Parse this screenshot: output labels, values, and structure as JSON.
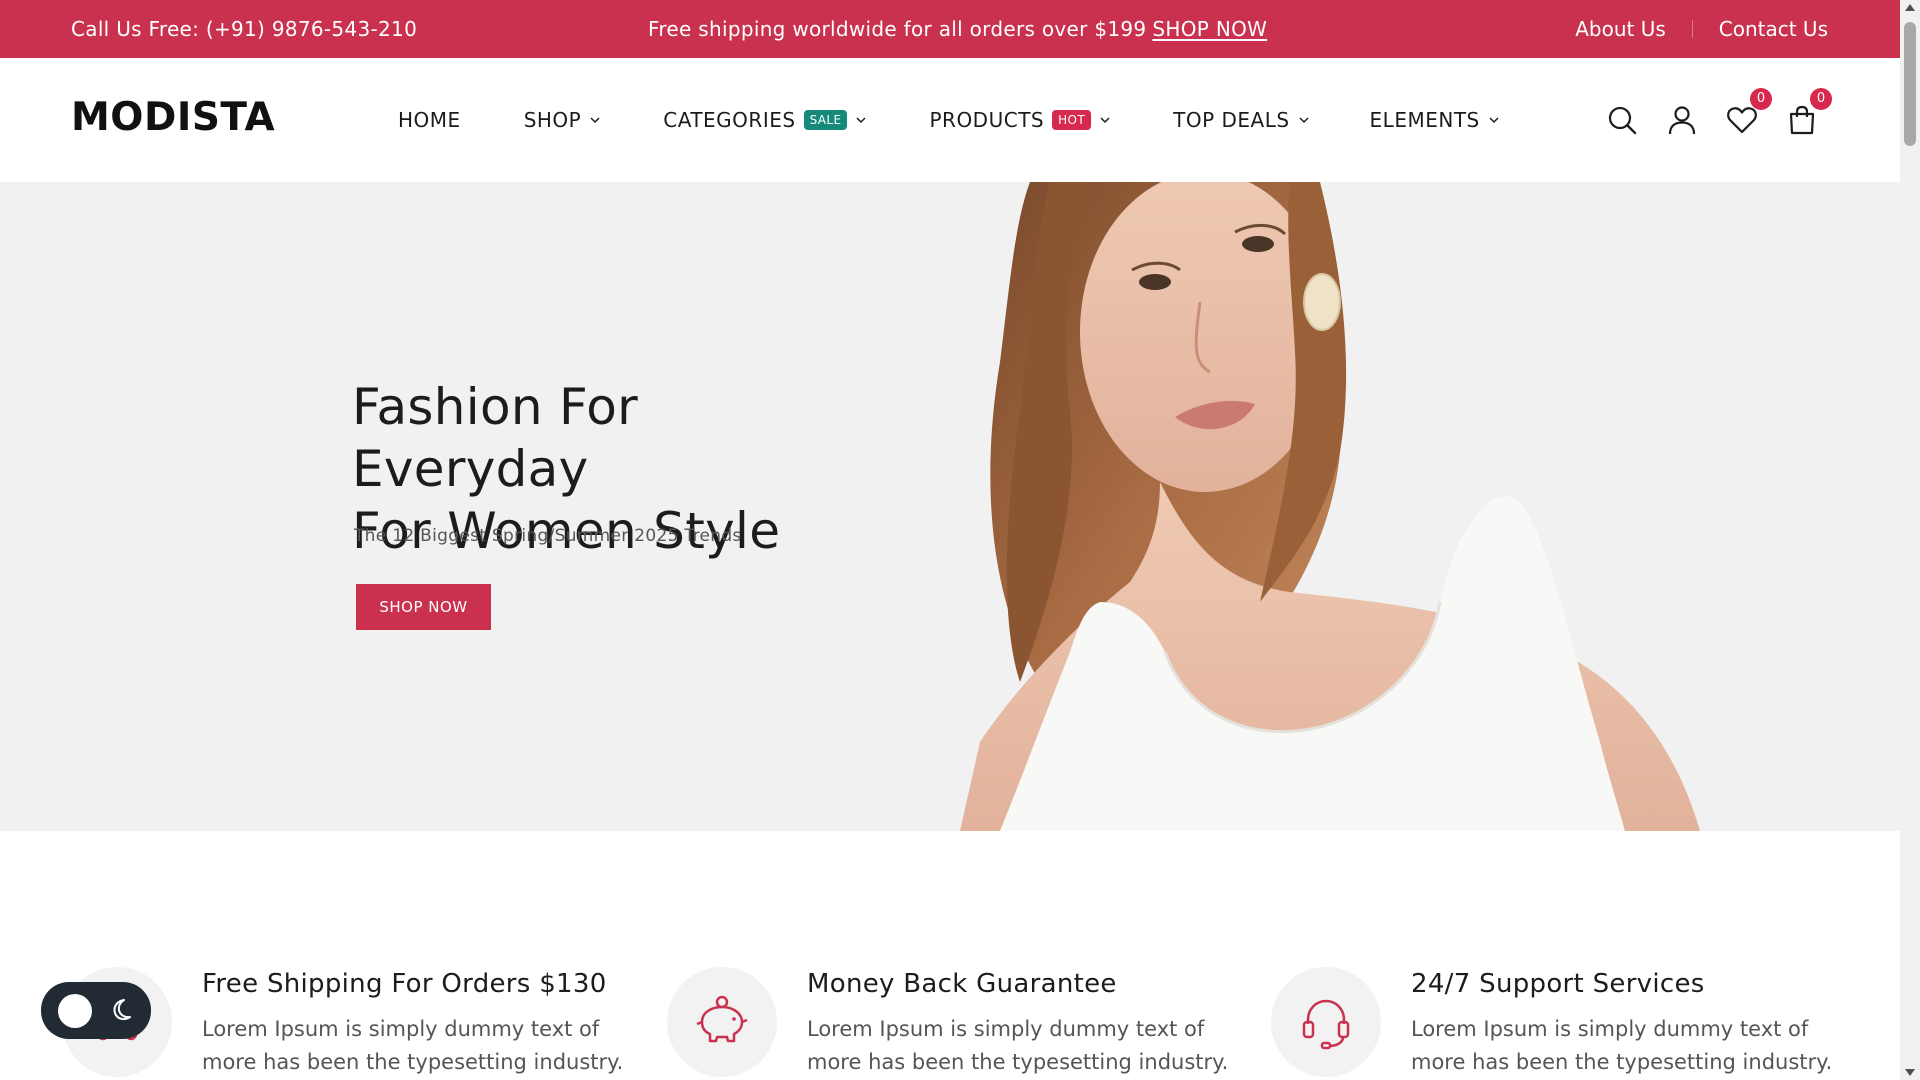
{
  "topbar": {
    "phone": "Call Us Free: (+91) 9876-543-210",
    "promo_text": "Free shipping worldwide for all orders over $199",
    "promo_link": "SHOP NOW",
    "about": "About Us",
    "contact": "Contact Us"
  },
  "header": {
    "logo": "MODISTA",
    "nav": {
      "home": "HOME",
      "shop": "SHOP",
      "categories": "CATEGORIES",
      "categories_badge": "SALE",
      "products": "PRODUCTS",
      "products_badge": "HOT",
      "top_deals": "TOP DEALS",
      "elements": "ELEMENTS"
    },
    "wishlist_count": "0",
    "cart_count": "0"
  },
  "hero": {
    "title_line1": "Fashion For Everyday",
    "title_line2": "For Women Style",
    "subtitle": "The 12 Biggest Spring/Summer 2025 Trends",
    "button": "SHOP NOW"
  },
  "features": [
    {
      "title": "Free Shipping For Orders $130",
      "desc": "Lorem Ipsum is simply dummy text of more has been the typesetting industry.",
      "icon": "delivery-icon"
    },
    {
      "title": "Money Back Guarantee",
      "desc": "Lorem Ipsum is simply dummy text of more has been the typesetting industry.",
      "icon": "piggy-bank-icon"
    },
    {
      "title": "24/7 Support Services",
      "desc": "Lorem Ipsum is simply dummy text of more has been the typesetting industry.",
      "icon": "headset-icon"
    }
  ],
  "colors": {
    "brand": "#c9314e",
    "sale_badge": "#158a7b",
    "hot_badge": "#d6294d",
    "hero_bg": "#f1f1f1",
    "toggle_bg": "#222a34"
  }
}
